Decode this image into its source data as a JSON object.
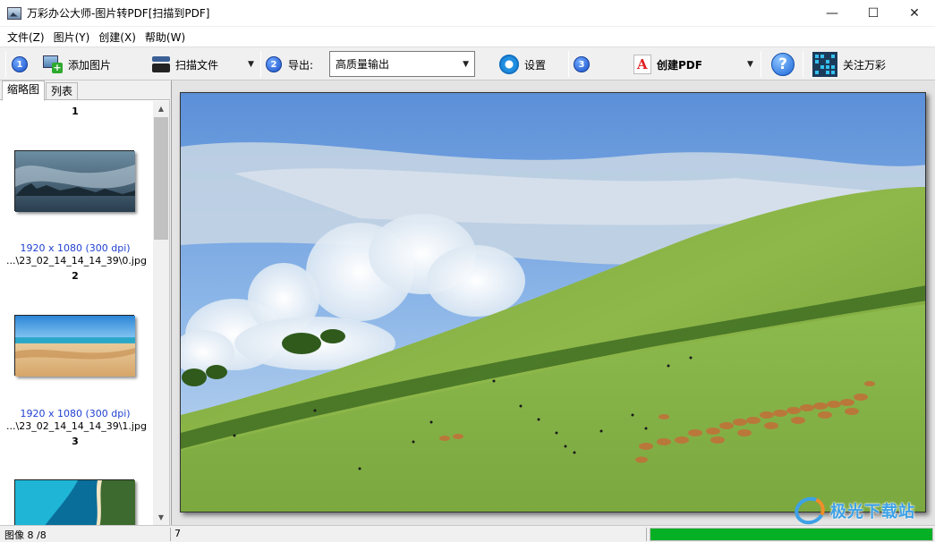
{
  "window": {
    "title": "万彩办公大师-图片转PDF[扫描到PDF]",
    "minimize": "—",
    "maximize": "☐",
    "close": "✕"
  },
  "menu": [
    "文件(Z)",
    "图片(Y)",
    "创建(X)",
    "帮助(W)"
  ],
  "toolbar": {
    "step1": "1",
    "add_image": "添加图片",
    "scan_file": "扫描文件",
    "step2": "2",
    "export_label": "导出:",
    "export_value": "高质量输出",
    "settings": "设置",
    "step3": "3",
    "create_pdf": "创建PDF",
    "help": "?",
    "follow": "关注万彩"
  },
  "sidebar": {
    "tabs": [
      "缩略图",
      "列表"
    ],
    "active_tab": 0,
    "thumbnails": [
      {
        "num": "1",
        "dims": "1920 x 1080 (300 dpi)",
        "file": "...\\23_02_14_14_14_39\\0.jpg"
      },
      {
        "num": "2",
        "dims": "1920 x 1080 (300 dpi)",
        "file": "...\\23_02_14_14_14_39\\1.jpg"
      },
      {
        "num": "3"
      }
    ]
  },
  "status": {
    "image_count": "图像 8 /8",
    "current": "7",
    "progress_fraction": 1.0
  },
  "watermark": "极光下载站",
  "colors": {
    "progress": "#06b025",
    "dims_text": "#1f3fd0",
    "step_badge": "#1b53c9"
  }
}
